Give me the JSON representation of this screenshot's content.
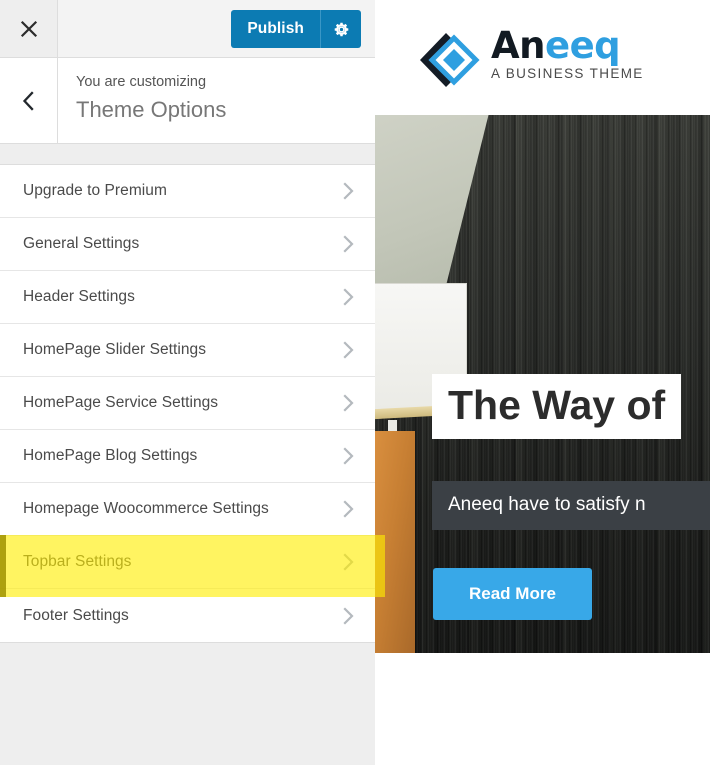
{
  "customizer": {
    "close_icon": "close-x-icon",
    "back_icon": "chevron-left-icon",
    "publish_label": "Publish",
    "gear_icon": "gear-icon",
    "subtitle": "You are customizing",
    "title": "Theme Options",
    "accent_color": "#0c7bb3",
    "highlight_color": "#ffed00",
    "sections": [
      {
        "label": "Upgrade to Premium",
        "chevron": "chevron-right-icon",
        "highlighted": false
      },
      {
        "label": "General Settings",
        "chevron": "chevron-right-icon",
        "highlighted": false
      },
      {
        "label": "Header Settings",
        "chevron": "chevron-right-icon",
        "highlighted": false
      },
      {
        "label": "HomePage Slider Settings",
        "chevron": "chevron-right-icon",
        "highlighted": false
      },
      {
        "label": "HomePage Service Settings",
        "chevron": "chevron-right-icon",
        "highlighted": false
      },
      {
        "label": "HomePage Blog Settings",
        "chevron": "chevron-right-icon",
        "highlighted": false
      },
      {
        "label": "Homepage Woocommerce Settings",
        "chevron": "chevron-right-icon",
        "highlighted": false
      },
      {
        "label": "Topbar Settings",
        "chevron": "chevron-right-icon",
        "highlighted": true
      },
      {
        "label": "Footer Settings",
        "chevron": "chevron-right-icon",
        "highlighted": false
      }
    ]
  },
  "preview": {
    "logo": {
      "mark": "aneeq-diamond-logo-icon",
      "word_part_1": "An",
      "word_part_2": "eeq",
      "tagline": "A BUSINESS THEME",
      "color_dark": "#121a22",
      "color_blue": "#2f9fe0"
    },
    "slider": {
      "headline": "The Way of",
      "subtitle": "Aneeq have to satisfy n",
      "button_label": "Read More",
      "button_color": "#38a8e8",
      "subtitle_bg": "#3b4045"
    }
  }
}
